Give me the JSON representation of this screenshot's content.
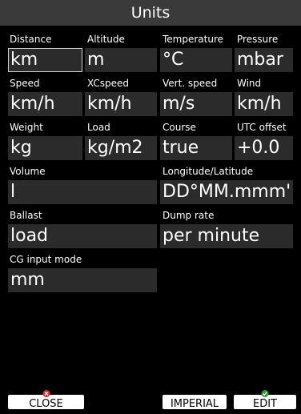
{
  "title": "Units",
  "fields": {
    "distance": {
      "label": "Distance",
      "value": "km"
    },
    "altitude": {
      "label": "Altitude",
      "value": "m"
    },
    "temperature": {
      "label": "Temperature",
      "value": "°C"
    },
    "pressure": {
      "label": "Pressure",
      "value": "mbar"
    },
    "speed": {
      "label": "Speed",
      "value": "km/h"
    },
    "xcspeed": {
      "label": "XCspeed",
      "value": "km/h"
    },
    "vert_speed": {
      "label": "Vert. speed",
      "value": "m/s"
    },
    "wind": {
      "label": "Wind",
      "value": "km/h"
    },
    "weight": {
      "label": "Weight",
      "value": "kg"
    },
    "load": {
      "label": "Load",
      "value": "kg/m2"
    },
    "course": {
      "label": "Course",
      "value": "true"
    },
    "utc_offset": {
      "label": "UTC offset",
      "value": "+0.0"
    },
    "volume": {
      "label": "Volume",
      "value": "l"
    },
    "lon_lat": {
      "label": "Longitude/Latitude",
      "value": "DD°MM.mmm'"
    },
    "ballast": {
      "label": "Ballast",
      "value": "load"
    },
    "dump_rate": {
      "label": "Dump rate",
      "value": "per minute"
    },
    "cg_input_mode": {
      "label": "CG input mode",
      "value": "mm"
    }
  },
  "buttons": {
    "close": "CLOSE",
    "imperial": "IMPERIAL",
    "edit": "EDIT"
  },
  "colors": {
    "background": "#000000",
    "title_bar": "#3a3a3a",
    "field": "#2b2b2b",
    "close_icon": "#e03030",
    "edit_icon": "#2e9a3a"
  },
  "icons": {
    "close": "red-x-icon",
    "edit": "green-check-icon"
  }
}
